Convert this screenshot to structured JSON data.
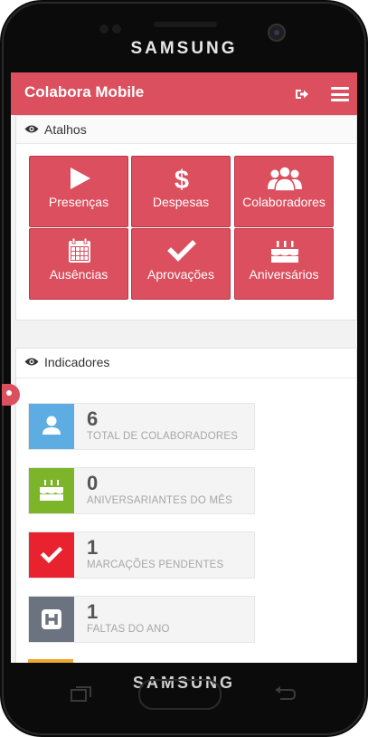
{
  "device": {
    "brand_top": "SAMSUNG",
    "brand_bottom": "SAMSUNG"
  },
  "app": {
    "title": "Colabora Mobile",
    "accent": "#db4f5e"
  },
  "shortcuts_panel": {
    "title": "Atalhos",
    "items": [
      {
        "label": "Presenças",
        "icon": "play-icon"
      },
      {
        "label": "Despesas",
        "icon": "dollar-icon"
      },
      {
        "label": "Colaboradores",
        "icon": "users-icon"
      },
      {
        "label": "Ausências",
        "icon": "calendar-icon"
      },
      {
        "label": "Aprovações",
        "icon": "check-icon"
      },
      {
        "label": "Aniversários",
        "icon": "birthday-cake-icon"
      }
    ]
  },
  "indicators_panel": {
    "title": "Indicadores",
    "items": [
      {
        "value": "6",
        "caption": "TOTAL DE COLABORADORES",
        "icon": "user-icon",
        "color": "#5dade2"
      },
      {
        "value": "0",
        "caption": "ANIVERSARIANTES DO MÊS",
        "icon": "birthday-cake-icon",
        "color": "#7cb52a"
      },
      {
        "value": "1",
        "caption": "MARCAÇÕES PENDENTES",
        "icon": "check-icon",
        "color": "#e8222e"
      },
      {
        "value": "1",
        "caption": "FALTAS DO ANO",
        "icon": "hospital-icon",
        "color": "#6b7380"
      }
    ]
  }
}
